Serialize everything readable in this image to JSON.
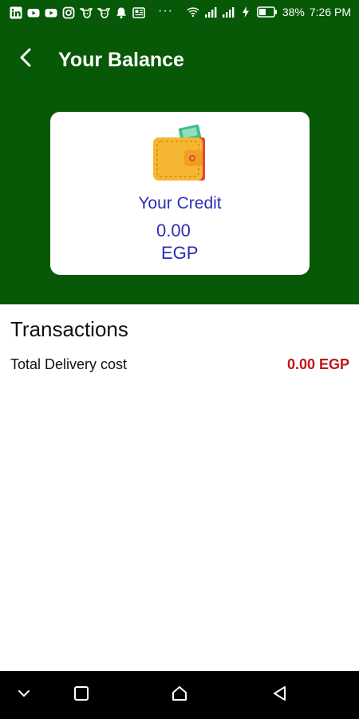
{
  "status_bar": {
    "battery": "38%",
    "time": "7:26 PM",
    "overflow": "···",
    "icons": [
      "linkedin-icon",
      "youtube-icon",
      "youtube-icon",
      "instagram-icon",
      "cow-icon",
      "cow-icon",
      "bell-icon",
      "news-icon",
      "wifi-icon",
      "signal-icon",
      "signal-icon",
      "charging-icon",
      "battery-icon"
    ]
  },
  "app_bar": {
    "back_icon": "chevron-left-icon",
    "title": "Your Balance",
    "background_color": "#075908"
  },
  "balance_card": {
    "icon": "wallet-icon",
    "label": "Your Credit",
    "amount": "0.00",
    "currency": "EGP",
    "text_color": "#2c2eb0"
  },
  "transactions": {
    "heading": "Transactions",
    "rows": [
      {
        "label": "Total Delivery cost",
        "value": "0.00 EGP",
        "value_color": "#c0151b"
      }
    ]
  },
  "nav_bar": {
    "buttons": [
      "chevron-down-icon",
      "square-icon",
      "home-icon",
      "back-triangle-icon"
    ]
  }
}
